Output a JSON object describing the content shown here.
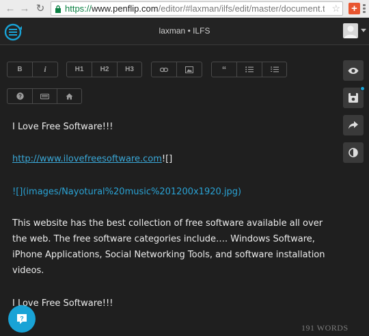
{
  "browser": {
    "url_scheme": "https://",
    "url_host": "www.penflip.com",
    "url_path": "/editor/#laxman/ilfs/edit/master/document.t",
    "extension_label": "+"
  },
  "app": {
    "doc_title": "laxman • ILFS"
  },
  "toolbar": {
    "row1": [
      {
        "label": "B"
      },
      {
        "label": "i"
      },
      {
        "label": "H1"
      },
      {
        "label": "H2"
      },
      {
        "label": "H3"
      },
      {
        "label": "link"
      },
      {
        "label": "image"
      },
      {
        "label": "quote"
      },
      {
        "label": "bullet-list"
      },
      {
        "label": "numbered-list"
      }
    ],
    "row2": [
      {
        "label": "help"
      },
      {
        "label": "keyboard"
      },
      {
        "label": "home"
      }
    ],
    "bold": "B",
    "italic": "i",
    "h1": "H1",
    "h2": "H2",
    "h3": "H3",
    "quote": "“"
  },
  "editor": {
    "line1": "I Love Free Software!!!",
    "link_text": "http://www.ilovefreesoftware.com",
    "link_suffix": "![]",
    "image_prefix": "![]",
    "image_md": "(images/Nayotural%20music%201200x1920.jpg)",
    "para_line1": "This website has the best collection of free software available all over",
    "para_line2": "the web. The free software categories include…. Windows Software,",
    "para_line3": "iPhone Applications, Social Networking Tools, and software installation",
    "para_line4": "videos.",
    "line_last": "I Love Free Software!!!"
  },
  "status": {
    "word_count": "191 WORDS"
  },
  "colors": {
    "accent": "#19a3d6",
    "background": "#1f1f1f",
    "text": "#ececec"
  }
}
